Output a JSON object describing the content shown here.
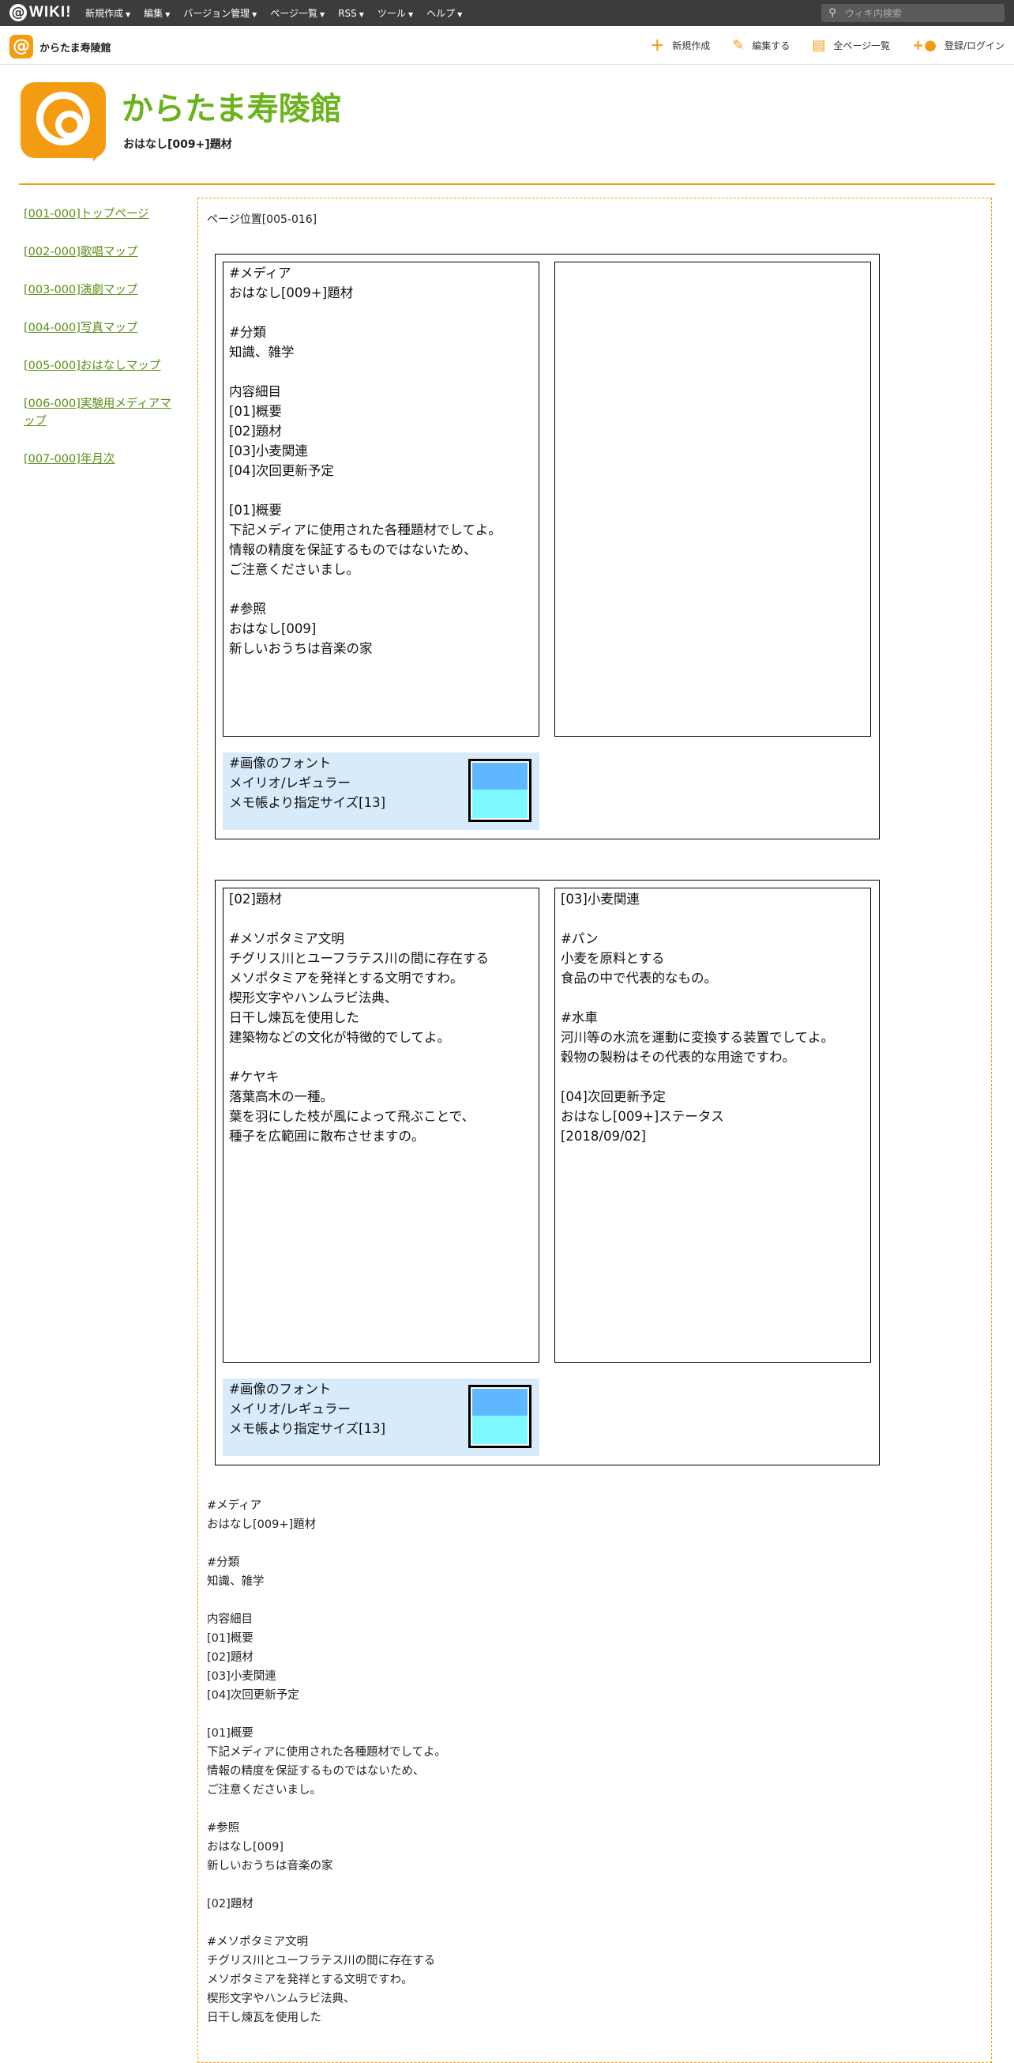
{
  "topbar": {
    "logo_text": "WIKI!",
    "menu": [
      "新規作成",
      "編集",
      "バージョン管理",
      "ページ一覧",
      "RSS",
      "ツール",
      "ヘルプ"
    ],
    "search_placeholder": "ウィキ内検索"
  },
  "subbar": {
    "site_name": "からたま寿陵館",
    "actions": [
      {
        "label": "新規作成",
        "icon": "plus-icon"
      },
      {
        "label": "編集する",
        "icon": "pencil-icon"
      },
      {
        "label": "全ページ一覧",
        "icon": "document-icon"
      },
      {
        "label": "登録/ログイン",
        "icon": "user-add-icon"
      }
    ],
    "accent_color": "#f39c12"
  },
  "header": {
    "title": "からたま寿陵館",
    "subtitle": "おはなし[009+]題材",
    "title_color": "#6ab31d"
  },
  "sidenav": [
    "[001-000]トップページ",
    "[002-000]歌唱マップ",
    "[003-000]演劇マップ",
    "[004-000]写真マップ",
    "[005-000]おはなしマップ",
    "[006-000]実験用メディアマップ",
    "[007-000]年月次"
  ],
  "main": {
    "position": "ページ位置[005-016]",
    "panel1": {
      "left_text": "#メディア\nおはなし[009+]題材\n\n#分類\n知識、雑学\n\n内容細目\n[01]概要\n[02]題材\n[03]小麦関連\n[04]次回更新予定\n\n[01]概要\n下記メディアに使用された各種題材でしてよ。\n情報の精度を保証するものではないため、\nご注意くださいまし。\n\n#参照\nおはなし[009]\n新しいおうちは音楽の家",
      "right_text": "",
      "font_note": "#画像のフォント\nメイリオ/レギュラー\nメモ帳より指定サイズ[13]"
    },
    "panel2": {
      "left_text": "[02]題材\n\n#メソポタミア文明\nチグリス川とユーフラテス川の間に存在する\nメソポタミアを発祥とする文明ですわ。\n楔形文字やハンムラビ法典、\n日干し煉瓦を使用した\n建築物などの文化が特徴的でしてよ。\n\n#ケヤキ\n落葉高木の一種。\n葉を羽にした枝が風によって飛ぶことで、\n種子を広範囲に散布させますの。",
      "right_text": "[03]小麦関連\n\n#パン\n小麦を原料とする\n食品の中で代表的なもの。\n\n#水車\n河川等の水流を運動に変換する装置でしてよ。\n穀物の製粉はその代表的な用途ですわ。\n\n[04]次回更新予定\nおはなし[009+]ステータス\n[2018/09/02]",
      "font_note": "#画像のフォント\nメイリオ/レギュラー\nメモ帳より指定サイズ[13]"
    },
    "plain_text": "#メディア\nおはなし[009+]題材\n\n#分類\n知識、雑学\n\n内容細目\n[01]概要\n[02]題材\n[03]小麦関連\n[04]次回更新予定\n\n[01]概要\n下記メディアに使用された各種題材でしてよ。\n情報の精度を保証するものではないため、\nご注意くださいまし。\n\n#参照\nおはなし[009]\n新しいおうちは音楽の家\n\n[02]題材\n\n#メソポタミア文明\nチグリス川とユーフラテス川の間に存在する\nメソポタミアを発祥とする文明ですわ。\n楔形文字やハンムラビ法典、\n日干し煉瓦を使用した",
    "swatch_colors": {
      "top": "#5fb7ff",
      "bottom": "#7cfaff"
    }
  }
}
